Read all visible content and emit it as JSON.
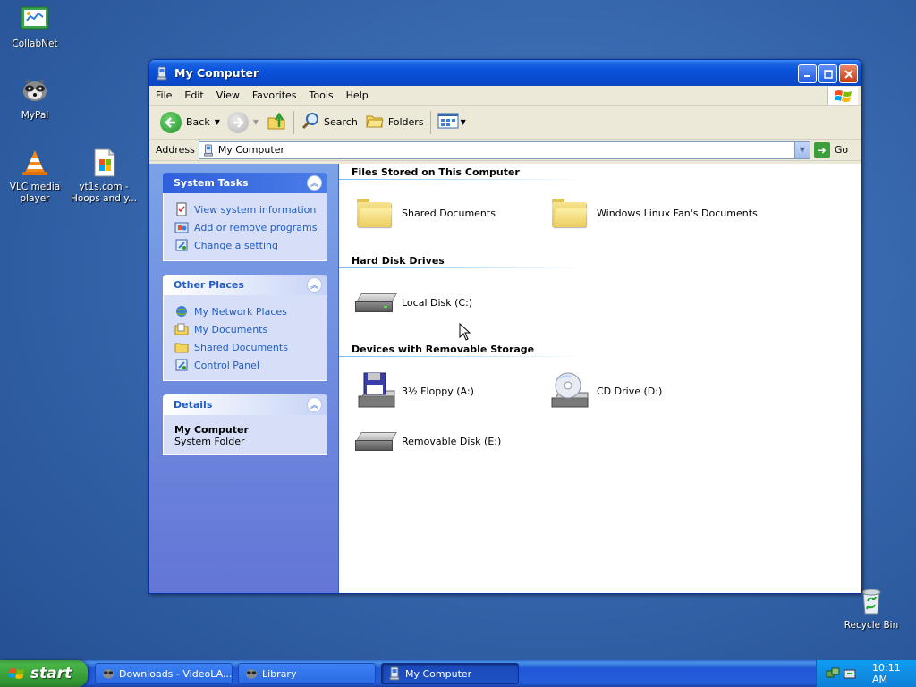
{
  "desktop": {
    "icons": [
      {
        "label": "CollabNet"
      },
      {
        "label": "MyPal"
      },
      {
        "label": "VLC media player"
      },
      {
        "label": "yt1s.com - Hoops and y..."
      },
      {
        "label": "Recycle Bin"
      }
    ]
  },
  "window": {
    "title": "My Computer",
    "menu": [
      "File",
      "Edit",
      "View",
      "Favorites",
      "Tools",
      "Help"
    ],
    "toolbar": {
      "back": "Back",
      "search": "Search",
      "folders": "Folders"
    },
    "address": {
      "label": "Address",
      "value": "My Computer",
      "go": "Go"
    },
    "taskpane": {
      "system_tasks": {
        "title": "System Tasks",
        "links": [
          "View system information",
          "Add or remove programs",
          "Change a setting"
        ]
      },
      "other_places": {
        "title": "Other Places",
        "links": [
          "My Network Places",
          "My Documents",
          "Shared Documents",
          "Control Panel"
        ]
      },
      "details": {
        "title": "Details",
        "name": "My Computer",
        "type": "System Folder"
      }
    },
    "groups": {
      "files": {
        "title": "Files Stored on This Computer",
        "items": [
          "Shared Documents",
          "Windows Linux Fan's Documents"
        ]
      },
      "hdd": {
        "title": "Hard Disk Drives",
        "items": [
          "Local Disk (C:)"
        ]
      },
      "removable": {
        "title": "Devices with Removable Storage",
        "items": [
          "3½ Floppy (A:)",
          "CD Drive (D:)",
          "Removable Disk (E:)"
        ]
      }
    }
  },
  "taskbar": {
    "start": "start",
    "tasks": [
      "Downloads - VideoLA...",
      "Library",
      "My Computer"
    ],
    "clock": "10:11 AM"
  },
  "colors": {
    "titlebar": "#0a53dc",
    "taskpane_link": "#215dc6",
    "start_green": "#3c9a3c"
  }
}
